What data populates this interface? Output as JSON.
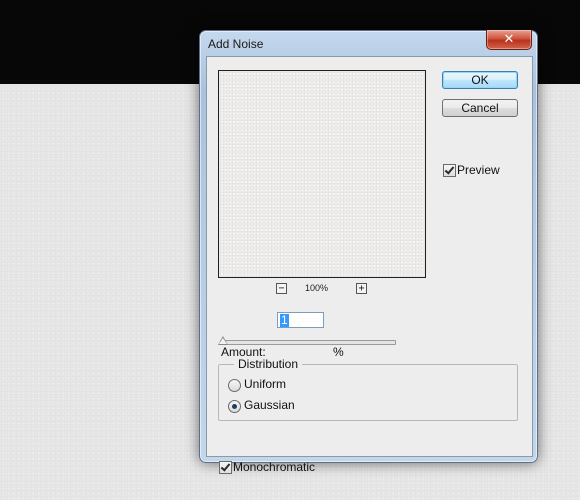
{
  "dialog": {
    "title": "Add Noise",
    "close_glyph": "✕"
  },
  "preview": {
    "zoom_out_glyph": "−",
    "zoom_in_glyph": "+",
    "zoom_level": "100%"
  },
  "buttons": {
    "ok": "OK",
    "cancel": "Cancel"
  },
  "preview_toggle": {
    "label": "Preview",
    "checked": true
  },
  "amount": {
    "label": "Amount:",
    "value": "1",
    "unit": "%",
    "slider_fraction": 0.0
  },
  "distribution": {
    "title": "Distribution",
    "options": [
      {
        "label": "Uniform",
        "selected": false
      },
      {
        "label": "Gaussian",
        "selected": true
      }
    ]
  },
  "monochromatic": {
    "label": "Monochromatic",
    "checked": true
  },
  "colors": {
    "close_button": "#c7452c",
    "ok_accent": "#3c7fb1",
    "selection": "#3399ff"
  }
}
